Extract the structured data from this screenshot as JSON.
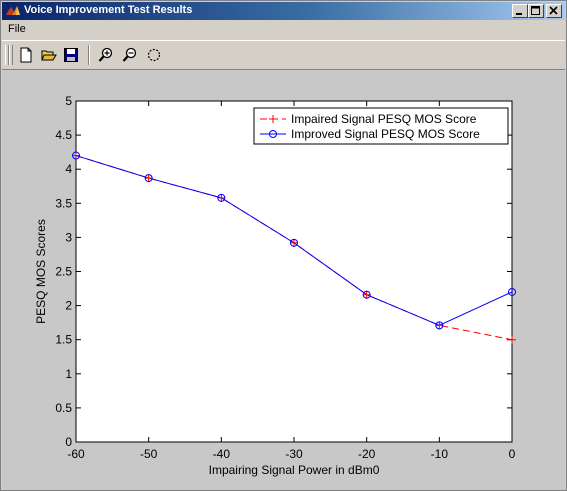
{
  "window": {
    "title": "Voice Improvement Test Results"
  },
  "menu": {
    "items": [
      {
        "label": "File"
      }
    ]
  },
  "toolbar": {
    "buttons": [
      {
        "icon": "new-file-icon"
      },
      {
        "icon": "open-folder-icon"
      },
      {
        "icon": "save-icon"
      },
      {
        "icon": "zoom-in-icon"
      },
      {
        "icon": "zoom-out-icon"
      },
      {
        "icon": "rotate-icon"
      }
    ]
  },
  "chart_data": {
    "type": "line",
    "title": "",
    "xlabel": "Impairing Signal Power in dBm0",
    "ylabel": "PESQ MOS Scores",
    "xlim": [
      -60,
      0
    ],
    "ylim": [
      0,
      5
    ],
    "xticks": [
      "-60",
      "-50",
      "-40",
      "-30",
      "-20",
      "-10",
      "0"
    ],
    "yticks": [
      "0",
      "0.5",
      "1",
      "1.5",
      "2",
      "2.5",
      "3",
      "3.5",
      "4",
      "4.5",
      "5"
    ],
    "grid": false,
    "legend_position": "top-right",
    "series": [
      {
        "name": "Impaired Signal PESQ MOS Score",
        "color": "#ff0000",
        "line_style": "dashed",
        "marker": "plus",
        "x": [
          -60,
          -50,
          -40,
          -30,
          -20,
          -10,
          0
        ],
        "y": [
          4.2,
          3.87,
          3.58,
          2.92,
          2.16,
          1.71,
          1.5
        ]
      },
      {
        "name": "Improved Signal PESQ MOS Score",
        "color": "#0000ff",
        "line_style": "solid",
        "marker": "circle",
        "x": [
          -60,
          -50,
          -40,
          -30,
          -20,
          -10,
          0
        ],
        "y": [
          4.2,
          3.87,
          3.58,
          2.92,
          2.16,
          1.71,
          2.2
        ]
      }
    ]
  }
}
